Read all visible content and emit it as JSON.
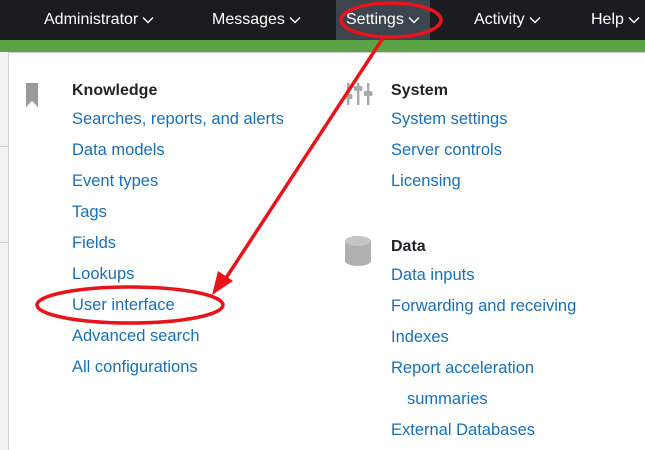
{
  "nav": {
    "items": [
      {
        "label": "Administrator",
        "active": false
      },
      {
        "label": "Messages",
        "active": false
      },
      {
        "label": "Settings",
        "active": true
      },
      {
        "label": "Activity",
        "active": false
      },
      {
        "label": "Help",
        "active": false
      }
    ]
  },
  "dropdown": {
    "knowledge": {
      "title": "Knowledge",
      "icon": "bookmark-icon",
      "items": [
        "Searches, reports, and alerts",
        "Data models",
        "Event types",
        "Tags",
        "Fields",
        "Lookups",
        "User interface",
        "Advanced search",
        "All configurations"
      ]
    },
    "system": {
      "title": "System",
      "icon": "sliders-icon",
      "items": [
        "System settings",
        "Server controls",
        "Licensing"
      ]
    },
    "data": {
      "title": "Data",
      "icon": "database-icon",
      "items": [
        "Data inputs",
        "Forwarding and receiving",
        "Indexes",
        "Report acceleration",
        "summaries",
        "External Databases"
      ]
    }
  },
  "annotations": {
    "color": "#e8141c",
    "highlighted": [
      "Settings",
      "User interface"
    ]
  },
  "colors": {
    "nav_bg": "#1a1c21",
    "nav_active_bg": "#3c444d",
    "accent_green": "#5ba446",
    "link": "#1a6fb3"
  }
}
